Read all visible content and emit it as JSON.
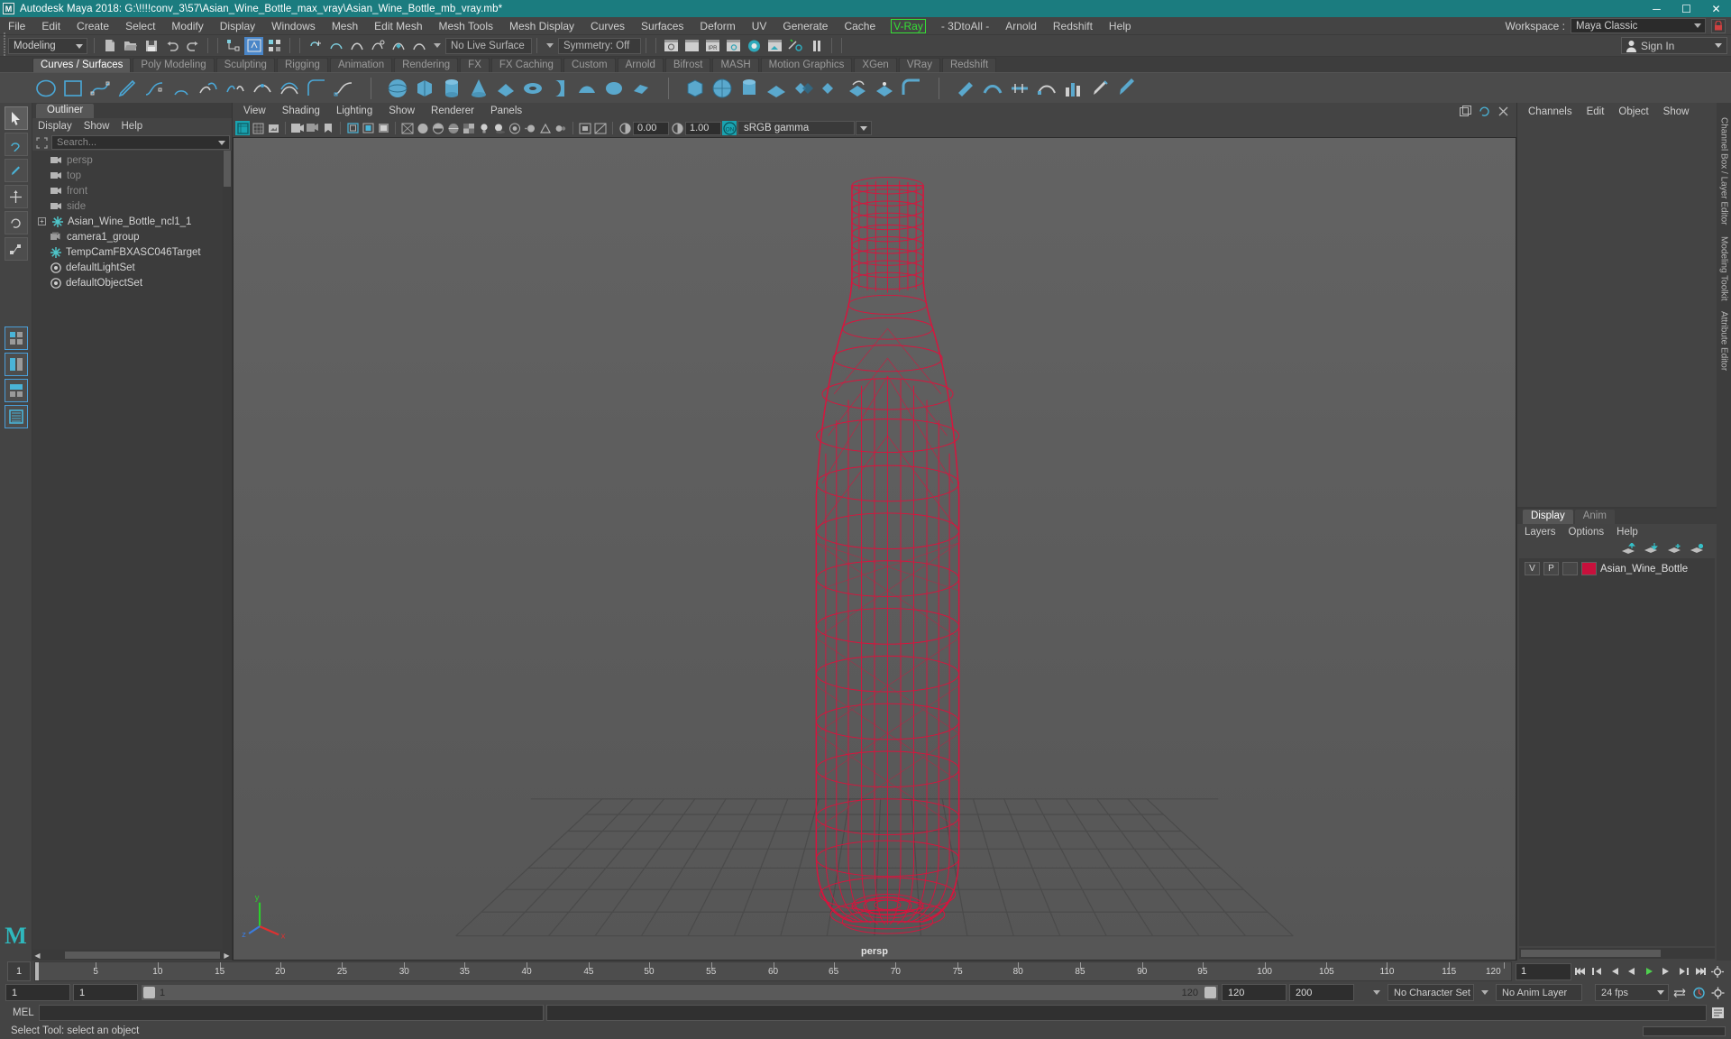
{
  "window": {
    "title": "Autodesk Maya 2018: G:\\!!!!conv_3\\57\\Asian_Wine_Bottle_max_vray\\Asian_Wine_Bottle_mb_vray.mb*",
    "app_icon": "maya-icon",
    "minimize": "─",
    "maximize": "☐",
    "close": "✕"
  },
  "menubar": {
    "items": [
      {
        "label": "File"
      },
      {
        "label": "Edit"
      },
      {
        "label": "Create"
      },
      {
        "label": "Select"
      },
      {
        "label": "Modify"
      },
      {
        "label": "Display"
      },
      {
        "label": "Windows"
      },
      {
        "label": "Mesh"
      },
      {
        "label": "Edit Mesh"
      },
      {
        "label": "Mesh Tools"
      },
      {
        "label": "Mesh Display"
      },
      {
        "label": "Curves"
      },
      {
        "label": "Surfaces"
      },
      {
        "label": "Deform"
      },
      {
        "label": "UV"
      },
      {
        "label": "Generate"
      },
      {
        "label": "Cache"
      }
    ],
    "vray": "V-Ray",
    "after_vray": [
      {
        "label": "- 3DtoAll -"
      },
      {
        "label": "Arnold"
      },
      {
        "label": "Redshift"
      },
      {
        "label": "Help"
      }
    ],
    "workspace_label": "Workspace :",
    "workspace_value": "Maya Classic"
  },
  "statusbar": {
    "mode": "Modeling",
    "live_surface": "No Live Surface",
    "symmetry": "Symmetry: Off",
    "signin": "Sign In"
  },
  "shelf": {
    "tabs": [
      {
        "label": "Curves / Surfaces",
        "active": true
      },
      {
        "label": "Poly Modeling",
        "active": false
      },
      {
        "label": "Sculpting",
        "active": false
      },
      {
        "label": "Rigging",
        "active": false
      },
      {
        "label": "Animation",
        "active": false
      },
      {
        "label": "Rendering",
        "active": false
      },
      {
        "label": "FX",
        "active": false
      },
      {
        "label": "FX Caching",
        "active": false
      },
      {
        "label": "Custom",
        "active": false
      },
      {
        "label": "Arnold",
        "active": false
      },
      {
        "label": "Bifrost",
        "active": false
      },
      {
        "label": "MASH",
        "active": false
      },
      {
        "label": "Motion Graphics",
        "active": false
      },
      {
        "label": "XGen",
        "active": false
      },
      {
        "label": "VRay",
        "active": false
      },
      {
        "label": "Redshift",
        "active": false
      }
    ]
  },
  "outliner": {
    "tab": "Outliner",
    "menus": [
      "Display",
      "Show",
      "Help"
    ],
    "search_placeholder": "Search...",
    "items": [
      {
        "label": "persp",
        "icon": "camera-icon",
        "dim": true,
        "expand": false
      },
      {
        "label": "top",
        "icon": "camera-icon",
        "dim": true,
        "expand": false
      },
      {
        "label": "front",
        "icon": "camera-icon",
        "dim": true,
        "expand": false
      },
      {
        "label": "side",
        "icon": "camera-icon",
        "dim": true,
        "expand": false
      },
      {
        "label": "Asian_Wine_Bottle_ncl1_1",
        "icon": "transform-icon",
        "dim": false,
        "expand": true
      },
      {
        "label": "camera1_group",
        "icon": "camera-group-icon",
        "dim": false,
        "expand": false
      },
      {
        "label": "TempCamFBXASC046Target",
        "icon": "transform-icon",
        "dim": false,
        "expand": false
      },
      {
        "label": "defaultLightSet",
        "icon": "set-icon",
        "dim": false,
        "expand": false
      },
      {
        "label": "defaultObjectSet",
        "icon": "set-icon",
        "dim": false,
        "expand": false
      }
    ]
  },
  "viewport": {
    "menus": [
      "View",
      "Shading",
      "Lighting",
      "Show",
      "Renderer",
      "Panels"
    ],
    "exposure": "0.00",
    "gamma_value": "1.00",
    "color_space": "sRGB gamma",
    "camera_label": "persp",
    "axis": {
      "x": "x",
      "y": "y",
      "z": "z"
    }
  },
  "channelbox": {
    "tabs": [
      "Channels",
      "Edit",
      "Object",
      "Show"
    ],
    "side_tabs": [
      "Channel Box / Layer Editor",
      "Modeling Toolkit",
      "Attribute Editor"
    ]
  },
  "layers": {
    "tabs": [
      {
        "label": "Display",
        "active": true
      },
      {
        "label": "Anim",
        "active": false
      }
    ],
    "menus": [
      "Layers",
      "Options",
      "Help"
    ],
    "rows": [
      {
        "visibility": "V",
        "playback": "P",
        "shading": "",
        "color": "#c8103c",
        "name": "Asian_Wine_Bottle"
      }
    ]
  },
  "timeslider": {
    "current_frame": "1",
    "ticks": [
      {
        "value": "5",
        "pos": 5
      },
      {
        "value": "10",
        "pos": 10
      },
      {
        "value": "15",
        "pos": 15
      },
      {
        "value": "20",
        "pos": 20
      },
      {
        "value": "25",
        "pos": 25
      },
      {
        "value": "30",
        "pos": 30
      },
      {
        "value": "35",
        "pos": 35
      },
      {
        "value": "40",
        "pos": 40
      },
      {
        "value": "45",
        "pos": 45
      },
      {
        "value": "50",
        "pos": 50
      },
      {
        "value": "55",
        "pos": 55
      },
      {
        "value": "60",
        "pos": 60
      },
      {
        "value": "65",
        "pos": 65
      },
      {
        "value": "70",
        "pos": 70
      },
      {
        "value": "75",
        "pos": 75
      },
      {
        "value": "80",
        "pos": 80
      },
      {
        "value": "85",
        "pos": 85
      },
      {
        "value": "90",
        "pos": 90
      },
      {
        "value": "95",
        "pos": 95
      },
      {
        "value": "100",
        "pos": 100
      },
      {
        "value": "105",
        "pos": 105
      },
      {
        "value": "110",
        "pos": 110
      },
      {
        "value": "115",
        "pos": 115
      },
      {
        "value": "120",
        "pos": 120
      }
    ],
    "frame_field": "1",
    "key_field": "1"
  },
  "rangebar": {
    "start": "1",
    "anim_start": "1",
    "slider_left_label": "1",
    "slider_right_label": "120",
    "anim_end": "120",
    "end": "200",
    "character_set": "No Character Set",
    "anim_layer": "No Anim Layer",
    "fps": "24 fps"
  },
  "commandline": {
    "label": "MEL",
    "input_value": "",
    "output_value": ""
  },
  "helpline": {
    "message": "Select Tool: select an object"
  },
  "colors": {
    "title_bar": "#1b7c7f",
    "accent_teal": "#2fb8bd",
    "vray_green": "#35e035",
    "wireframe_red": "#e01040",
    "selection_blue": "#4a86c8",
    "panel_bg": "#444444",
    "viewport_bg": "#5d5d5d"
  }
}
